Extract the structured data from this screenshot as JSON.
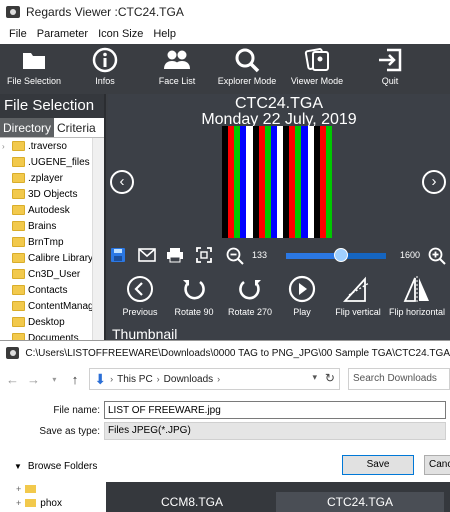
{
  "window": {
    "title": "Regards Viewer :CTC24.TGA"
  },
  "menu": {
    "items": [
      "File",
      "Parameter",
      "Icon Size",
      "Help"
    ]
  },
  "toolbar": {
    "items": [
      {
        "label": "File Selection",
        "icon": "folder-icon"
      },
      {
        "label": "Infos",
        "icon": "info-icon"
      },
      {
        "label": "Face List",
        "icon": "people-icon"
      },
      {
        "label": "Explorer Mode",
        "icon": "search-icon"
      },
      {
        "label": "Viewer Mode",
        "icon": "image-cards-icon"
      },
      {
        "label": "Quit",
        "icon": "exit-icon"
      }
    ]
  },
  "left_panel": {
    "heading": "File Selection",
    "tabs": [
      "Directory",
      "Criteria"
    ],
    "folders": [
      ".traverso",
      ".UGENE_files",
      ".zplayer",
      "3D Objects",
      "Autodesk",
      "Brains",
      "BrnTmp",
      "Calibre Library",
      "Cn3D_User",
      "Contacts",
      "ContentManager",
      "Desktop",
      "Documents"
    ]
  },
  "viewer": {
    "file_title": "CTC24.TGA",
    "date": "Monday 22 July, 2019",
    "zoom_min": "133",
    "zoom_max": "1600",
    "zoom_fraction": 0.55,
    "stripe_colors": [
      "#000000",
      "#ff0000",
      "#00c800",
      "#0000ff",
      "#ffffff",
      "#000000",
      "#ff0000",
      "#00c800",
      "#0000ff",
      "#ffffff",
      "#000000",
      "#ff0000",
      "#00c800",
      "#0000ff",
      "#ffffff",
      "#000000",
      "#ff0000",
      "#00c800"
    ],
    "actions": [
      {
        "label": "Previous",
        "icon": "circle-left-icon"
      },
      {
        "label": "Rotate 90",
        "icon": "rotate-ccw-icon"
      },
      {
        "label": "Rotate 270",
        "icon": "rotate-cw-icon"
      },
      {
        "label": "Play",
        "icon": "play-icon"
      },
      {
        "label": "Flip vertical",
        "icon": "flip-vertical-icon"
      },
      {
        "label": "Flip horizontal",
        "icon": "flip-horizontal-icon"
      }
    ],
    "thumbnail_label": "Thumbnail"
  },
  "save_dialog": {
    "path": "C:\\Users\\LISTOFFREEWARE\\Downloads\\0000 TAG to PNG_JPG\\00 Sample TGA\\CTC24.TGA",
    "breadcrumbs": [
      "This PC",
      "Downloads"
    ],
    "search_placeholder": "Search Downloads",
    "file_name_label": "File name:",
    "file_name_value": "LIST OF FREEWARE.jpg",
    "save_type_label": "Save as type:",
    "save_type_value": "Files JPEG(*.JPG)",
    "browse_folders": "Browse Folders",
    "save_button": "Save",
    "cancel_button": "Cancel"
  },
  "bottom": {
    "tree_item": "phox",
    "thumbnails": [
      "CCM8.TGA",
      "CTC24.TGA"
    ]
  }
}
